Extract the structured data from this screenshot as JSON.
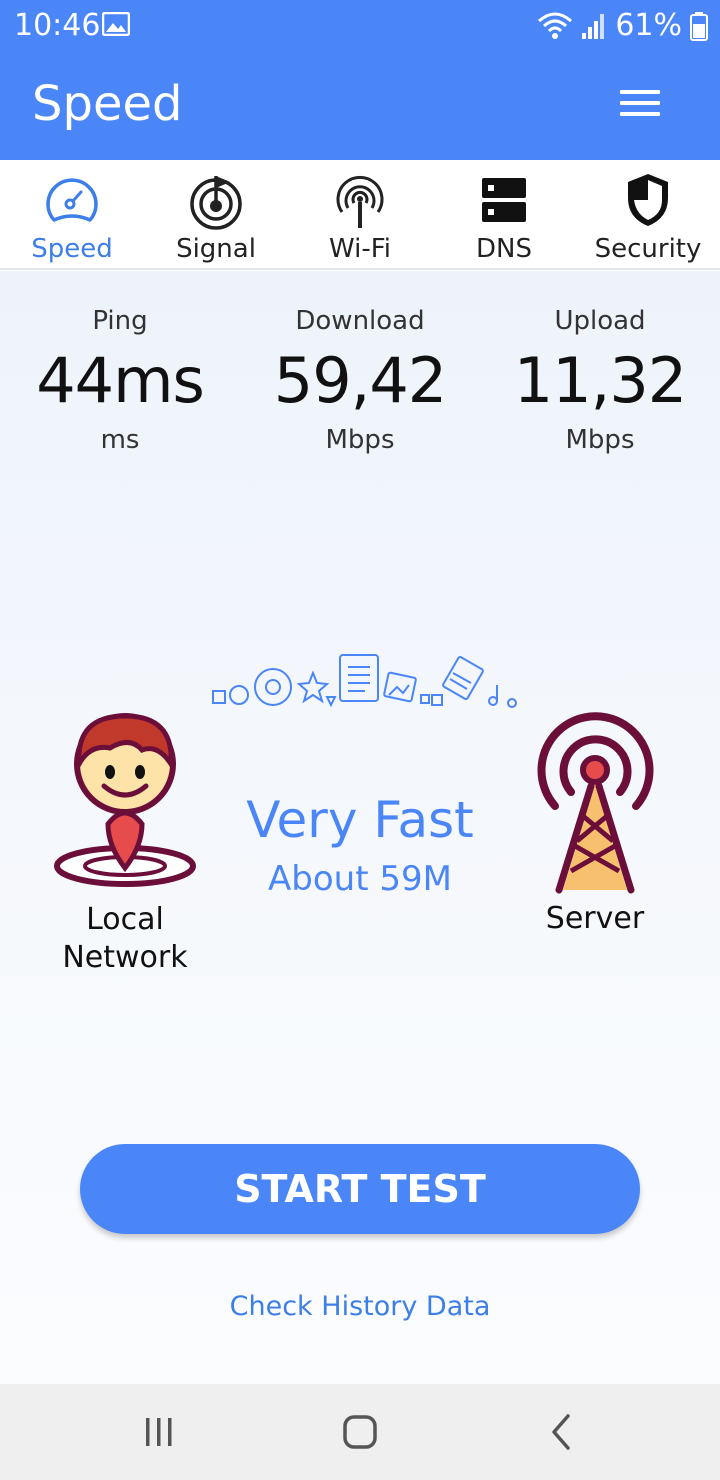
{
  "status_bar": {
    "time": "10:46",
    "battery": "61%"
  },
  "app_bar": {
    "title": "Speed"
  },
  "tabs": [
    {
      "label": "Speed",
      "icon": "speedometer-icon",
      "active": true
    },
    {
      "label": "Signal",
      "icon": "signal-radar-icon",
      "active": false
    },
    {
      "label": "Wi-Fi",
      "icon": "wifi-antenna-icon",
      "active": false
    },
    {
      "label": "DNS",
      "icon": "server-icon",
      "active": false
    },
    {
      "label": "Security",
      "icon": "shield-icon",
      "active": false
    }
  ],
  "stats": {
    "ping": {
      "label": "Ping",
      "value": "44ms",
      "unit": "ms"
    },
    "download": {
      "label": "Download",
      "value": "59,42",
      "unit": "Mbps"
    },
    "upload": {
      "label": "Upload",
      "value": "11,32",
      "unit": "Mbps"
    }
  },
  "result": {
    "rating": "Very Fast",
    "about": "About 59M"
  },
  "illustration": {
    "local_label": "Local\nNetwork",
    "server_label": "Server"
  },
  "actions": {
    "start_test": "START TEST",
    "history": "Check History Data"
  },
  "colors": {
    "accent": "#4a86f7",
    "illustration_dark": "#6b0f3a",
    "skin": "#fde3a7",
    "hair": "#c0392b"
  }
}
